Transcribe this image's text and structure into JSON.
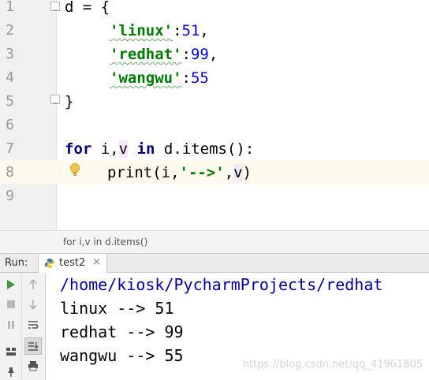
{
  "editor": {
    "line_numbers": [
      "1",
      "2",
      "3",
      "4",
      "5",
      "6",
      "7",
      "8",
      "9"
    ],
    "line1": {
      "name": "d",
      "op": " = ",
      "brace": "{"
    },
    "line2": {
      "key": "'linux'",
      "colon": ":",
      "value": "51",
      "comma": ","
    },
    "line3": {
      "key": "'redhat'",
      "colon": ":",
      "value": "99",
      "comma": ","
    },
    "line4": {
      "key": "'wangwu'",
      "colon": ":",
      "value": "55"
    },
    "line5": {
      "brace": "}"
    },
    "line7": {
      "kw_for": "for",
      "i": " i,",
      "v": "v",
      "kw_in": " in ",
      "rest": "d.items():"
    },
    "line8": {
      "fn": "print(i,",
      "str": "'-->'",
      "comma": ",",
      "v": "v",
      "close": ")"
    }
  },
  "breadcrumb": {
    "text": "for i,v in d.items()"
  },
  "run_panel": {
    "label": "Run:",
    "tab_label": "test2",
    "tab_close": "×"
  },
  "console": {
    "lines": [
      "/home/kiosk/PycharmProjects/redhat",
      "linux --> 51",
      "redhat --> 99",
      "wangwu --> 55"
    ]
  },
  "watermark": "https://blog.csdn.net/qq_41961805",
  "colors": {
    "keyword": "#000080",
    "string": "#008000",
    "number": "#0000ff",
    "path": "#0000aa",
    "current_line": "#fcfaed"
  },
  "icons": [
    "fold-icon",
    "intention-bulb-icon",
    "python-file-icon",
    "run-icon",
    "stop-icon",
    "pause-icon",
    "up-arrow-icon",
    "down-arrow-icon",
    "soft-wrap-icon",
    "scroll-to-end-icon",
    "print-icon",
    "layout-icon",
    "pin-icon"
  ]
}
